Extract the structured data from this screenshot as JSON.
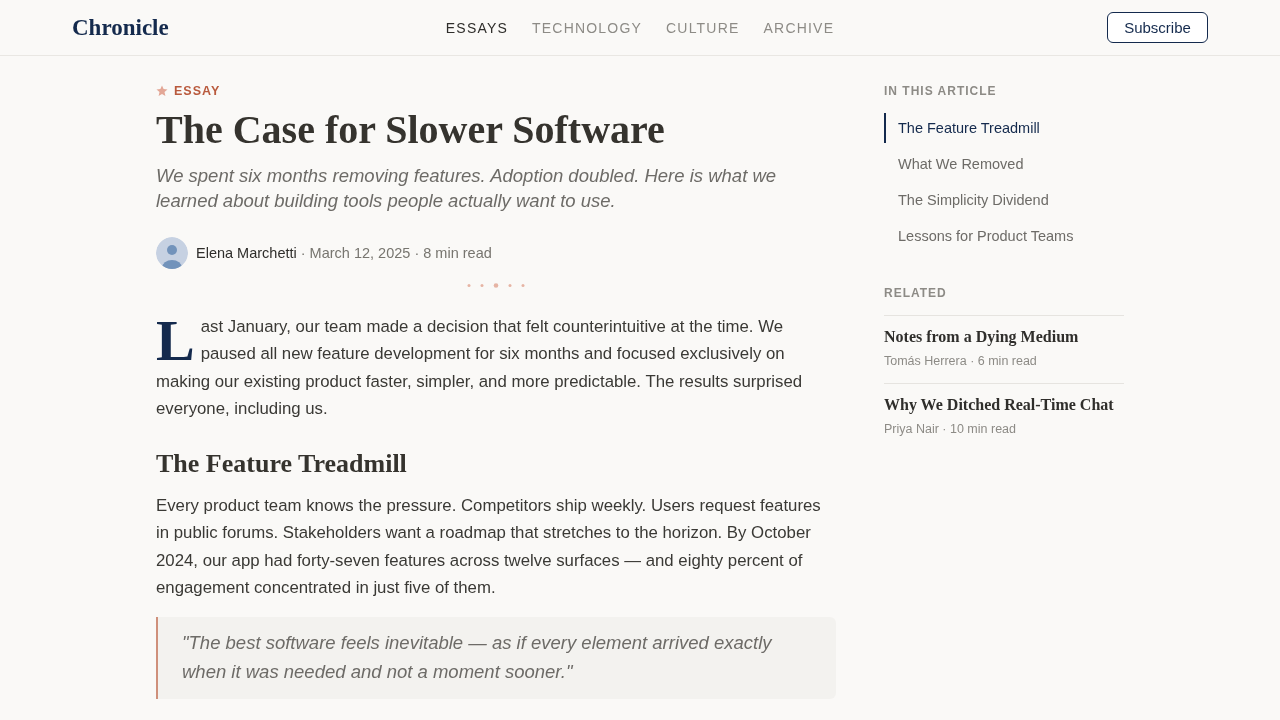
{
  "header": {
    "logo": "Chronicle",
    "nav": [
      {
        "label": "ESSAYS",
        "selected": true
      },
      {
        "label": "TECHNOLOGY",
        "selected": false
      },
      {
        "label": "CULTURE",
        "selected": false
      },
      {
        "label": "ARCHIVE",
        "selected": false
      }
    ],
    "subscribe_button": "Subscribe"
  },
  "article": {
    "category": "ESSAY",
    "title": "The Case for Slower Software",
    "subtitle": "We spent six months removing features. Adoption doubled. Here is what we learned about building tools people actually want to use.",
    "byline": {
      "author": "Elena Marchetti",
      "meta": "· March 12, 2025 · 8 min read"
    },
    "body": [
      {
        "kind": "paragraph",
        "drop_cap": true,
        "text": "Last January, our team made a decision that felt counterintuitive at the time. We paused all new feature development for six months and focused exclusively on making our existing product faster, simpler, and more predictable. The results surprised everyone, including us."
      },
      {
        "kind": "heading",
        "text": "The Feature Treadmill"
      },
      {
        "kind": "paragraph",
        "drop_cap": false,
        "text": "Every product team knows the pressure. Competitors ship weekly. Users request features in public forums. Stakeholders want a roadmap that stretches to the horizon. By October 2024, our app had forty-seven features across twelve surfaces — and eighty percent of engagement concentrated in just five of them."
      },
      {
        "kind": "quote",
        "text": "\"The best software feels inevitable — as if every element arrived exactly when it was needed and not a moment sooner.\""
      }
    ]
  },
  "sidebar": {
    "toc": {
      "title": "IN THIS ARTICLE",
      "items": [
        {
          "label": "The Feature Treadmill",
          "selected": true
        },
        {
          "label": "What We Removed",
          "selected": false
        },
        {
          "label": "The Simplicity Dividend",
          "selected": false
        },
        {
          "label": "Lessons for Product Teams",
          "selected": false
        }
      ]
    },
    "related": {
      "title": "RELATED",
      "items": [
        {
          "title": "Notes from a Dying Medium",
          "meta": "Tomás Herrera · 6 min read"
        },
        {
          "title": "Why We Ditched Real-Time Chat",
          "meta": "Priya Nair · 10 min read"
        }
      ]
    }
  }
}
